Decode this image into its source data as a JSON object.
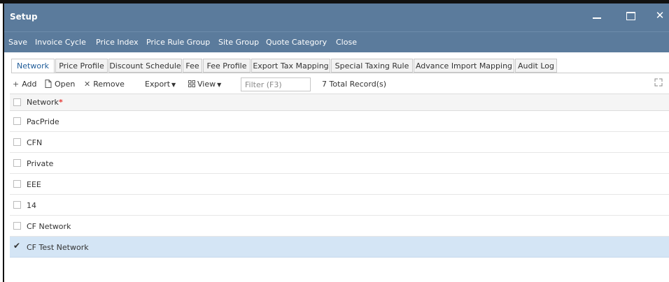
{
  "window": {
    "title": "Setup"
  },
  "menu": [
    {
      "label": "Save",
      "name": "menu-save"
    },
    {
      "label": "Invoice Cycle",
      "name": "menu-invoice-cycle"
    },
    {
      "label": "Price Index",
      "name": "menu-price-index"
    },
    {
      "label": "Price Rule Group",
      "name": "menu-price-rule-group"
    },
    {
      "label": "Site Group",
      "name": "menu-site-group"
    },
    {
      "label": "Quote Category",
      "name": "menu-quote-category"
    },
    {
      "label": "Close",
      "name": "menu-close"
    }
  ],
  "tabs": [
    {
      "label": "Network",
      "active": true
    },
    {
      "label": "Price Profile"
    },
    {
      "label": "Discount Schedule"
    },
    {
      "label": "Fee"
    },
    {
      "label": "Fee Profile"
    },
    {
      "label": "Export Tax Mapping"
    },
    {
      "label": "Special Taxing Rule"
    },
    {
      "label": "Advance Import Mapping"
    },
    {
      "label": "Audit Log"
    }
  ],
  "toolbar": {
    "add": "Add",
    "open": "Open",
    "remove": "Remove",
    "export": "Export",
    "view": "View",
    "filter_placeholder": "Filter (F3)",
    "record_count": "7 Total Record(s)"
  },
  "grid": {
    "column": "Network",
    "required_mark": "*",
    "rows": [
      {
        "network": "PacPride",
        "checked": false
      },
      {
        "network": "CFN",
        "checked": false
      },
      {
        "network": "Private",
        "checked": false
      },
      {
        "network": "EEE",
        "checked": false
      },
      {
        "network": "14",
        "checked": false
      },
      {
        "network": "CF Network",
        "checked": false
      },
      {
        "network": "CF Test Network",
        "checked": true
      }
    ]
  },
  "icons": {
    "add": "plus-icon",
    "open": "document-icon",
    "remove": "x-icon",
    "view": "grid-icon",
    "export": "chevron-down-icon",
    "expand": "expand-icon"
  },
  "colors": {
    "titlebar": "#5b7b9c",
    "active_tab_text": "#1f5c99",
    "selected_row": "#d4e5f5",
    "required": "#e53935"
  }
}
